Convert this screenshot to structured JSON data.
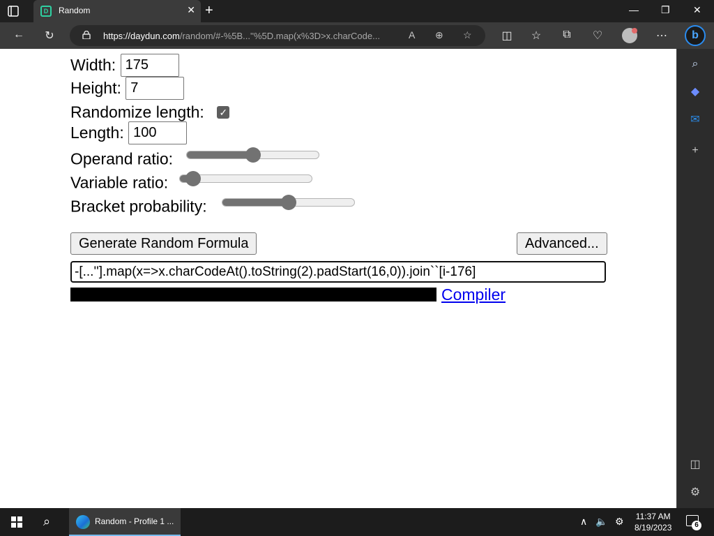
{
  "browser": {
    "tab_title": "Random",
    "url_host": "https://daydun.com",
    "url_rest": "/random/#-%5B...''%5D.map(x%3D>x.charCode..."
  },
  "form": {
    "width_label": "Width:",
    "width_value": "175",
    "height_label": "Height:",
    "height_value": "7",
    "randomize_label": "Randomize length:",
    "randomize_checked": true,
    "length_label": "Length:",
    "length_value": "100",
    "operand_label": "Operand ratio:",
    "operand_value": 0.5,
    "variable_label": "Variable ratio:",
    "variable_value": 0.1,
    "bracket_label": "Bracket probability:",
    "bracket_value": 0.5
  },
  "buttons": {
    "generate": "Generate Random Formula",
    "advanced": "Advanced..."
  },
  "formula_text": "-[...''].map(x=>x.charCodeAt().toString(2).padStart(16,0)).join``[i-176]",
  "compiler_link": "Compiler",
  "taskbar": {
    "app_label": "Random - Profile 1 ...",
    "time": "11:37 AM",
    "date": "8/19/2023",
    "notification_count": "6"
  }
}
